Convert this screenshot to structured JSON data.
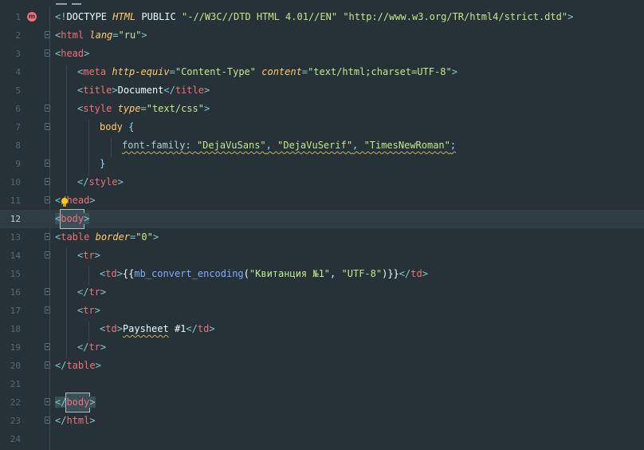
{
  "editor": {
    "line_numbers": [
      "1",
      "2",
      "3",
      "4",
      "5",
      "6",
      "7",
      "8",
      "9",
      "10",
      "11",
      "12",
      "13",
      "14",
      "15",
      "16",
      "17",
      "18",
      "19",
      "20",
      "21",
      "22",
      "23",
      "24"
    ],
    "current_line": "12",
    "error_marker": "m",
    "lines": {
      "l1": {
        "lt": "<!",
        "kw": "DOCTYPE",
        "html": "HTML",
        "pub": "PUBLIC",
        "s1": "\"-//W3C//DTD HTML 4.01//EN\"",
        "s2": "\"http://www.w3.org/TR/html4/strict.dtd\"",
        "gt": ">"
      },
      "l2": {
        "lt": "<",
        "tag": "html",
        "attr": "lang",
        "eq": "=",
        "val": "\"ru\"",
        "gt": ">"
      },
      "l3": {
        "lt": "<",
        "tag": "head",
        "gt": ">"
      },
      "l4": {
        "lt": "<",
        "tag": "meta",
        "attr1": "http-equiv",
        "eq1": "=",
        "val1": "\"Content-Type\"",
        "attr2": "content",
        "eq2": "=",
        "val2": "\"text/html;charset=UTF-8\"",
        "gt": ">"
      },
      "l5": {
        "lt": "<",
        "tag": "title",
        "gt": ">",
        "text": "Document",
        "lt2": "</",
        "tag2": "title",
        "gt2": ">"
      },
      "l6": {
        "lt": "<",
        "tag": "style",
        "attr": "type",
        "eq": "=",
        "val": "\"text/css\"",
        "gt": ">"
      },
      "l7": {
        "sel": "body",
        "brace": "{"
      },
      "l8": {
        "prop": "font-family",
        "colon": ":",
        "v1": "\"DejaVuSans\"",
        "c1": ",",
        "v2": "\"DejaVuSerif\"",
        "c2": ",",
        "v3": "\"TimesNewRoman\"",
        "semi": ";"
      },
      "l9": {
        "brace": "}"
      },
      "l10": {
        "lt": "</",
        "tag": "style",
        "gt": ">"
      },
      "l11": {
        "lt": "</",
        "tag": "head",
        "gt": ">"
      },
      "l12": {
        "lt": "<",
        "tag": "body",
        "gt": ">"
      },
      "l13": {
        "lt": "<",
        "tag": "table",
        "attr": "border",
        "eq": "=",
        "val": "\"0\"",
        "gt": ">"
      },
      "l14": {
        "lt": "<",
        "tag": "tr",
        "gt": ">"
      },
      "l15": {
        "lt": "<",
        "tag": "td",
        "gt": ">",
        "open": "{{",
        "fn": "mb_convert_encoding",
        "paren": "(",
        "s1": "\"Квитанция №1\"",
        "comma": ",",
        "s2": "\"UTF-8\"",
        "close": ")}}",
        "lt2": "</",
        "tag2": "td",
        "gt2": ">"
      },
      "l16": {
        "lt": "</",
        "tag": "tr",
        "gt": ">"
      },
      "l17": {
        "lt": "<",
        "tag": "tr",
        "gt": ">"
      },
      "l18": {
        "lt": "<",
        "tag": "td",
        "gt": ">",
        "text": "Paysheet",
        "text2": "#1",
        "lt2": "</",
        "tag2": "td",
        "gt2": ">"
      },
      "l19": {
        "lt": "</",
        "tag": "tr",
        "gt": ">"
      },
      "l20": {
        "lt": "</",
        "tag": "table",
        "gt": ">"
      },
      "l22": {
        "lt": "</",
        "tag": "body",
        "gt": ">"
      },
      "l23": {
        "lt": "</",
        "tag": "html",
        "gt": ">"
      }
    }
  }
}
